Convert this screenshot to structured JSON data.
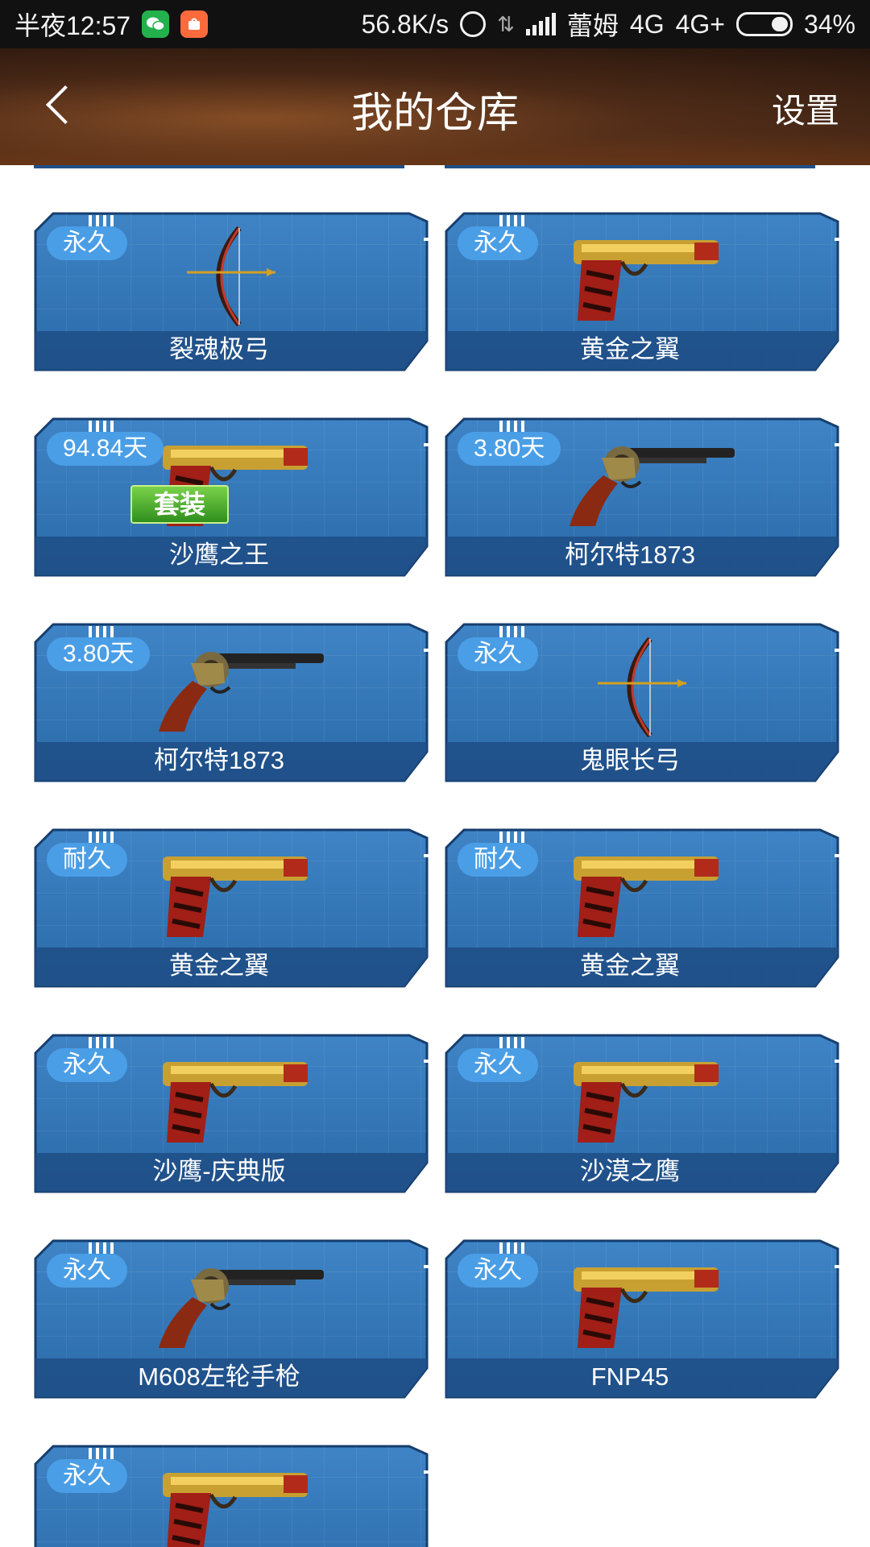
{
  "status_bar": {
    "time": "半夜12:57",
    "net_speed": "56.8K/s",
    "carrier": "蕾姆",
    "network_1": "4G",
    "network_2": "4G+",
    "battery": "34%",
    "icons": [
      "wechat-icon",
      "mi-store-icon",
      "alarm-icon",
      "data-transfer-icon",
      "signal-icon",
      "battery-icon"
    ]
  },
  "header": {
    "title": "我的仓库",
    "settings_label": "设置",
    "back_icon": "chevron-left-icon"
  },
  "colors": {
    "card_blue": "#2f6fae",
    "card_border": "#163e6e",
    "name_bar": "#1f4f88",
    "badge": "#4a9ee6",
    "suit_tag_green": "#3aa826"
  },
  "items": [
    {
      "duration": "永久",
      "name": "裂魂极弓",
      "weapon": "bow-icon"
    },
    {
      "duration": "永久",
      "name": "黄金之翼",
      "weapon": "pistol-icon"
    },
    {
      "duration": "94.84天",
      "name": "沙鹰之王",
      "weapon": "pistol-icon",
      "tag": "套装"
    },
    {
      "duration": "3.80天",
      "name": "柯尔特1873",
      "weapon": "revolver-icon"
    },
    {
      "duration": "3.80天",
      "name": "柯尔特1873",
      "weapon": "revolver-icon"
    },
    {
      "duration": "永久",
      "name": "鬼眼长弓",
      "weapon": "bow-icon"
    },
    {
      "duration": "耐久",
      "name": "黄金之翼",
      "weapon": "pistol-icon"
    },
    {
      "duration": "耐久",
      "name": "黄金之翼",
      "weapon": "pistol-icon"
    },
    {
      "duration": "永久",
      "name": "沙鹰-庆典版",
      "weapon": "pistol-icon"
    },
    {
      "duration": "永久",
      "name": "沙漠之鹰",
      "weapon": "pistol-icon"
    },
    {
      "duration": "永久",
      "name": "M608左轮手枪",
      "weapon": "revolver-icon"
    },
    {
      "duration": "永久",
      "name": "FNP45",
      "weapon": "pistol-icon"
    },
    {
      "duration": "永久",
      "name": "",
      "weapon": "pistol-icon"
    }
  ]
}
